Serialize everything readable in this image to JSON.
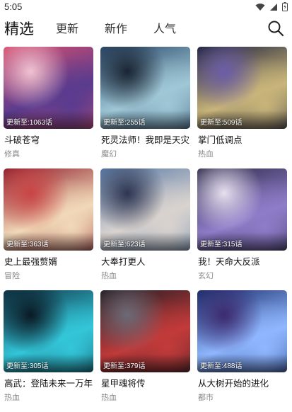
{
  "status": {
    "time": "5:05"
  },
  "tabs": [
    {
      "label": "精选",
      "active": true
    },
    {
      "label": "更新",
      "active": false
    },
    {
      "label": "新作",
      "active": false
    },
    {
      "label": "人气",
      "active": false
    }
  ],
  "cards": [
    {
      "title": "斗破苍穹",
      "genre": "修真",
      "update": "更新至:1063话",
      "palette": [
        "#d94f6e",
        "#5a3b8e",
        "#f0c2d0"
      ]
    },
    {
      "title": "死灵法师！我即是天灾",
      "genre": "魔幻",
      "update": "更新至:255话",
      "palette": [
        "#2b4a6b",
        "#9fc7d6",
        "#1a2533"
      ]
    },
    {
      "title": "掌门低调点",
      "genre": "热血",
      "update": "更新至:509话",
      "palette": [
        "#1c1f3a",
        "#c9b57a",
        "#6b5da8"
      ]
    },
    {
      "title": "史上最强赘婿",
      "genre": "冒险",
      "update": "更新至:363话",
      "palette": [
        "#8e1e2c",
        "#f1d9b8",
        "#c94545"
      ]
    },
    {
      "title": "大奉打更人",
      "genre": "热血",
      "update": "更新至:623话",
      "palette": [
        "#5a7ba8",
        "#d9d3cf",
        "#2e3550"
      ]
    },
    {
      "title": "我！天命大反派",
      "genre": "玄幻",
      "update": "更新至:315话",
      "palette": [
        "#2b2945",
        "#8f7cc9",
        "#e6e0ef"
      ]
    },
    {
      "title": "高武：登陆未来一万年",
      "genre": "热血",
      "update": "更新至:305话",
      "palette": [
        "#0f3547",
        "#33c6d9",
        "#0a1a25"
      ]
    },
    {
      "title": "星甲魂将传",
      "genre": "热血",
      "update": "更新至:379话",
      "palette": [
        "#1c1c22",
        "#c23a3a",
        "#6b6b77"
      ]
    },
    {
      "title": "从大树开始的进化",
      "genre": "都市",
      "update": "更新至:488话",
      "palette": [
        "#1a2d6b",
        "#8fb7ff",
        "#3d2a70"
      ]
    }
  ],
  "icons": {
    "search": "search-icon",
    "wifi": "wifi-icon",
    "signal": "signal-icon",
    "battery": "battery-icon"
  }
}
